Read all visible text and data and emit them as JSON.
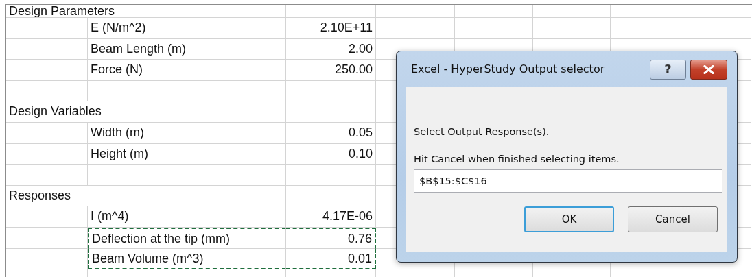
{
  "sheet": {
    "rows": [
      {
        "kind": "section",
        "label": "Design Parameters"
      },
      {
        "kind": "item",
        "label": "E (N/m^2)",
        "value": "2.10E+11",
        "selected": false
      },
      {
        "kind": "item",
        "label": "Beam Length (m)",
        "value": "2.00",
        "selected": false
      },
      {
        "kind": "item",
        "label": "Force (N)",
        "value": "250.00",
        "selected": false
      },
      {
        "kind": "blank"
      },
      {
        "kind": "section",
        "label": "Design Variables"
      },
      {
        "kind": "item",
        "label": "Width (m)",
        "value": "0.05",
        "selected": false
      },
      {
        "kind": "item",
        "label": "Height (m)",
        "value": "0.10",
        "selected": false
      },
      {
        "kind": "blank"
      },
      {
        "kind": "section",
        "label": "Responses"
      },
      {
        "kind": "item",
        "label": "I (m^4)",
        "value": "4.17E-06",
        "selected": false
      },
      {
        "kind": "item",
        "label": "Deflection at the tip (mm)",
        "value": "0.76",
        "selected": true
      },
      {
        "kind": "item",
        "label": "Beam Volume (m^3)",
        "value": "0.01",
        "selected": true
      },
      {
        "kind": "blank"
      }
    ]
  },
  "dialog": {
    "title": "Excel - HyperStudy Output selector",
    "help_button": "?",
    "messages": [
      "Select Output Response(s).",
      "Hit Cancel when finished selecting items."
    ],
    "input": {
      "value": "$B$15:$C$16"
    },
    "buttons": [
      {
        "label": "OK",
        "default": true
      },
      {
        "label": "Cancel",
        "default": false
      }
    ]
  }
}
